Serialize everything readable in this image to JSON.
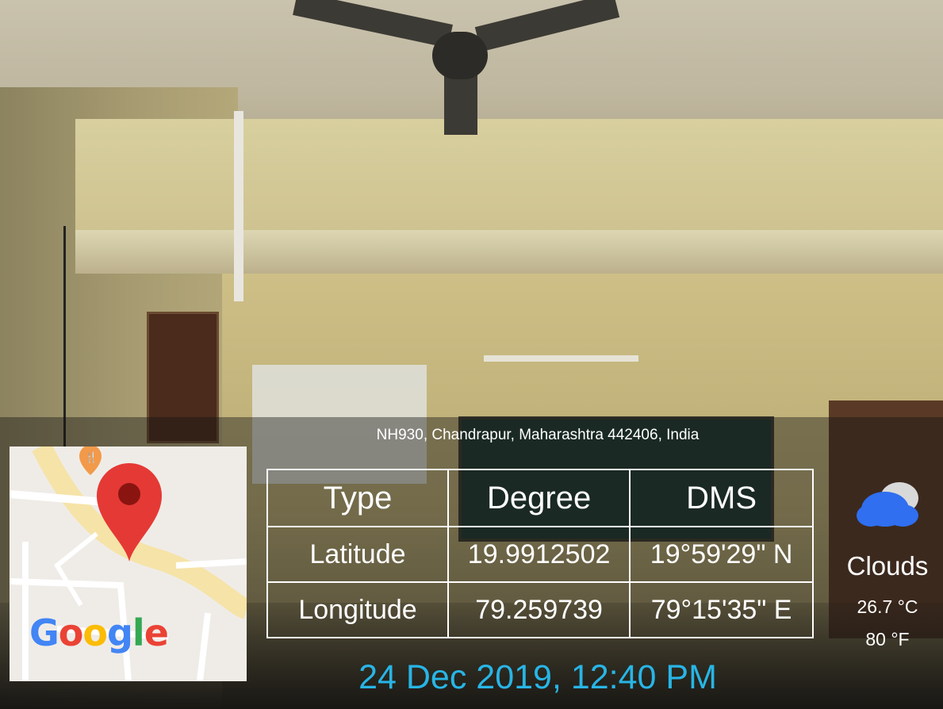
{
  "address": "NH930, Chandrapur, Maharashtra 442406, India",
  "map": {
    "logo_text": "Google",
    "logo_colors": [
      "#4285F4",
      "#EA4335",
      "#FBBC05",
      "#4285F4",
      "#34A853",
      "#EA4335"
    ],
    "pin_icon": "map-pin-icon",
    "restaurant_icon": "restaurant-icon"
  },
  "table": {
    "headers": [
      "Type",
      "Degree",
      "DMS"
    ],
    "rows": [
      [
        "Latitude",
        "19.9912502",
        "19°59'29\" N"
      ],
      [
        "Longitude",
        "79.259739",
        "79°15'35\" E"
      ]
    ]
  },
  "weather": {
    "icon": "cloud-icon",
    "condition": "Clouds",
    "temp_c": "26.7 °C",
    "temp_f": "80 °F"
  },
  "datetime": "24 Dec 2019, 12:40 PM",
  "colors": {
    "datetime": "#28b5e6",
    "pin": "#e53935",
    "cloud": "#2f6ff0"
  }
}
